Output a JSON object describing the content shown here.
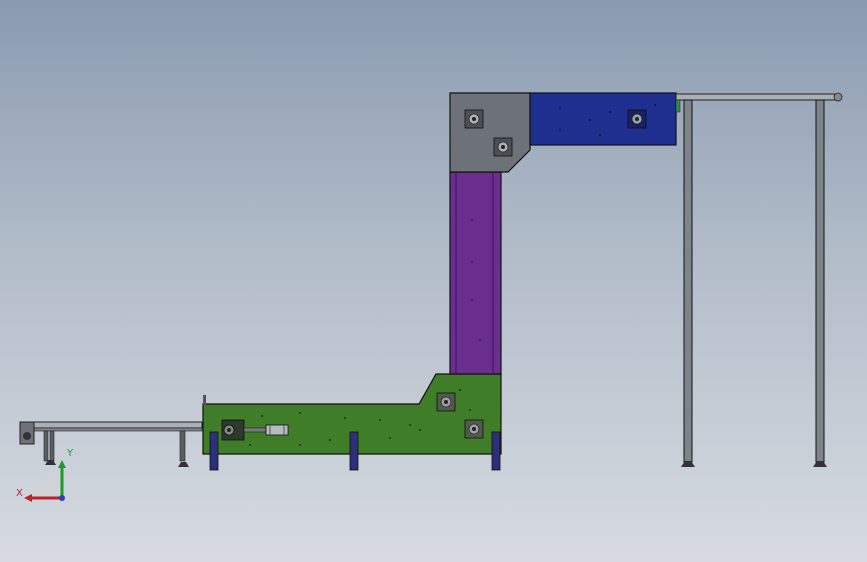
{
  "viewport": {
    "background_top": "#8a9bb0",
    "background_bottom": "#d7dbe1"
  },
  "model": {
    "parts": {
      "green_body_color": "#3f7d28",
      "purple_column_color": "#6a2e8e",
      "gray_corner_color": "#6d7278",
      "blue_top_color": "#1f2f8f",
      "leg_color": "#2c2f7a",
      "frame_color": "#9aa0a6"
    }
  },
  "triad": {
    "x_label": "X",
    "y_label": "Y",
    "x_color": "#c0202a",
    "y_color": "#1f9a2a",
    "z_color": "#2a3fbf"
  }
}
